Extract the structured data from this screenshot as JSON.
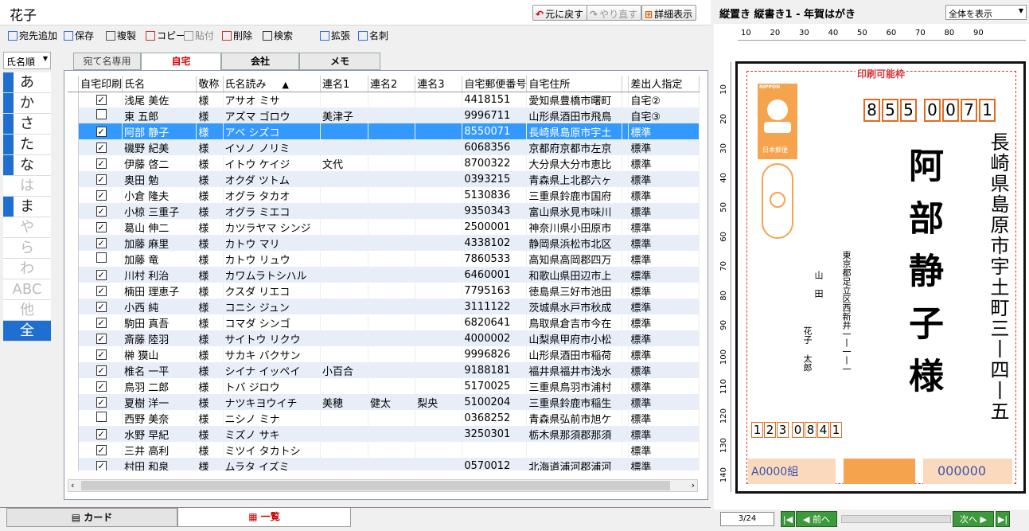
{
  "title": "花子",
  "top_buttons": {
    "undo": "元に戻す",
    "redo": "やり直す",
    "details": "詳細表示"
  },
  "toolbar": [
    "宛先追加",
    "保存",
    "複製",
    "コピー",
    "貼付",
    "削除",
    "検索",
    "拡張",
    "名刺"
  ],
  "sort_label": "氏名順",
  "kana_index": [
    {
      "label": "あ",
      "state": "active"
    },
    {
      "label": "か",
      "state": "active"
    },
    {
      "label": "さ",
      "state": "active"
    },
    {
      "label": "た",
      "state": "active"
    },
    {
      "label": "な",
      "state": "active"
    },
    {
      "label": "は",
      "state": "dim"
    },
    {
      "label": "ま",
      "state": "active"
    },
    {
      "label": "や",
      "state": "dim"
    },
    {
      "label": "ら",
      "state": "dim"
    },
    {
      "label": "わ",
      "state": "dim"
    },
    {
      "label": "ABC",
      "state": "dim"
    },
    {
      "label": "他",
      "state": "dim"
    },
    {
      "label": "全",
      "state": "selected"
    }
  ],
  "tabs": [
    "宛て名専用",
    "自宅",
    "会社",
    "メモ"
  ],
  "active_tab": "自宅",
  "columns": [
    "自宅印刷",
    "氏名",
    "敬称",
    "氏名読み",
    "連名1",
    "連名2",
    "連名3",
    "自宅郵便番号",
    "自宅住所",
    "差出人指定"
  ],
  "sort_indicator": "▲",
  "rows": [
    {
      "checked": true,
      "name": "浅尾 美佐",
      "honor": "様",
      "reading": "アサオ ミサ",
      "r1": "",
      "r2": "",
      "r3": "",
      "zip": "4418151",
      "addr": "愛知県豊橋市曙町",
      "sender": "自宅②"
    },
    {
      "checked": false,
      "name": "東 五郎",
      "honor": "様",
      "reading": "アズマ ゴロウ",
      "r1": "美津子",
      "r2": "",
      "r3": "",
      "zip": "9996711",
      "addr": "山形県酒田市飛鳥",
      "sender": "自宅③"
    },
    {
      "checked": true,
      "name": "阿部 静子",
      "honor": "様",
      "reading": "アベ シズコ",
      "r1": "",
      "r2": "",
      "r3": "",
      "zip": "8550071",
      "addr": "長崎県島原市宇土",
      "sender": "標準",
      "selected": true
    },
    {
      "checked": true,
      "name": "磯野 紀美",
      "honor": "様",
      "reading": "イソノ ノリミ",
      "r1": "",
      "r2": "",
      "r3": "",
      "zip": "6068356",
      "addr": "京都府京都市左京",
      "sender": "標準"
    },
    {
      "checked": true,
      "name": "伊藤 啓二",
      "honor": "様",
      "reading": "イトウ ケイジ",
      "r1": "文代",
      "r2": "",
      "r3": "",
      "zip": "8700322",
      "addr": "大分県大分市恵比",
      "sender": "標準"
    },
    {
      "checked": true,
      "name": "奥田 勉",
      "honor": "様",
      "reading": "オクダ ツトム",
      "r1": "",
      "r2": "",
      "r3": "",
      "zip": "0393215",
      "addr": "青森県上北郡六ヶ",
      "sender": "標準"
    },
    {
      "checked": true,
      "name": "小倉 隆夫",
      "honor": "様",
      "reading": "オグラ タカオ",
      "r1": "",
      "r2": "",
      "r3": "",
      "zip": "5130836",
      "addr": "三重県鈴鹿市国府",
      "sender": "標準"
    },
    {
      "checked": true,
      "name": "小椋 三重子",
      "honor": "様",
      "reading": "オグラ ミエコ",
      "r1": "",
      "r2": "",
      "r3": "",
      "zip": "9350343",
      "addr": "富山県氷見市味川",
      "sender": "標準"
    },
    {
      "checked": true,
      "name": "葛山 伸二",
      "honor": "様",
      "reading": "カツラヤマ シンジ",
      "r1": "",
      "r2": "",
      "r3": "",
      "zip": "2500001",
      "addr": "神奈川県小田原市",
      "sender": "標準"
    },
    {
      "checked": true,
      "name": "加藤 麻里",
      "honor": "様",
      "reading": "カトウ マリ",
      "r1": "",
      "r2": "",
      "r3": "",
      "zip": "4338102",
      "addr": "静岡県浜松市北区",
      "sender": "標準"
    },
    {
      "checked": false,
      "name": "加藤 竜",
      "honor": "様",
      "reading": "カトウ リュウ",
      "r1": "",
      "r2": "",
      "r3": "",
      "zip": "7860533",
      "addr": "高知県高岡郡四万",
      "sender": "標準"
    },
    {
      "checked": true,
      "name": "川村 利治",
      "honor": "様",
      "reading": "カワムラトシハル",
      "r1": "",
      "r2": "",
      "r3": "",
      "zip": "6460001",
      "addr": "和歌山県田辺市上",
      "sender": "標準"
    },
    {
      "checked": true,
      "name": "楠田 理恵子",
      "honor": "様",
      "reading": "クスダ リエコ",
      "r1": "",
      "r2": "",
      "r3": "",
      "zip": "7795163",
      "addr": "徳島県三好市池田",
      "sender": "標準"
    },
    {
      "checked": true,
      "name": "小西 純",
      "honor": "様",
      "reading": "コニシ ジュン",
      "r1": "",
      "r2": "",
      "r3": "",
      "zip": "3111122",
      "addr": "茨城県水戸市秋成",
      "sender": "標準"
    },
    {
      "checked": true,
      "name": "駒田 真吾",
      "honor": "様",
      "reading": "コマダ シンゴ",
      "r1": "",
      "r2": "",
      "r3": "",
      "zip": "6820641",
      "addr": "鳥取県倉吉市今在",
      "sender": "標準"
    },
    {
      "checked": true,
      "name": "斎藤 陸羽",
      "honor": "様",
      "reading": "サイトウ リクウ",
      "r1": "",
      "r2": "",
      "r3": "",
      "zip": "4000002",
      "addr": "山梨県甲府市小松",
      "sender": "標準"
    },
    {
      "checked": true,
      "name": "榊 獏山",
      "honor": "様",
      "reading": "サカキ バクサン",
      "r1": "",
      "r2": "",
      "r3": "",
      "zip": "9996826",
      "addr": "山形県酒田市稲荷",
      "sender": "標準"
    },
    {
      "checked": true,
      "name": "椎名 一平",
      "honor": "様",
      "reading": "シイナ イッペイ",
      "r1": "小百合",
      "r2": "",
      "r3": "",
      "zip": "9188181",
      "addr": "福井県福井市浅水",
      "sender": "標準"
    },
    {
      "checked": true,
      "name": "鳥羽 二郎",
      "honor": "様",
      "reading": "トバ ジロウ",
      "r1": "",
      "r2": "",
      "r3": "",
      "zip": "5170025",
      "addr": "三重県鳥羽市浦村",
      "sender": "標準"
    },
    {
      "checked": true,
      "name": "夏樹 洋一",
      "honor": "様",
      "reading": "ナツキヨウイチ",
      "r1": "美穂",
      "r2": "健太",
      "r3": "梨央",
      "zip": "5100204",
      "addr": "三重県鈴鹿市稲生",
      "sender": "標準"
    },
    {
      "checked": false,
      "name": "西野 美奈",
      "honor": "様",
      "reading": "ニシノ ミナ",
      "r1": "",
      "r2": "",
      "r3": "",
      "zip": "0368252",
      "addr": "青森県弘前市旭ケ",
      "sender": "標準"
    },
    {
      "checked": true,
      "name": "水野 早紀",
      "honor": "様",
      "reading": "ミズノ サキ",
      "r1": "",
      "r2": "",
      "r3": "",
      "zip": "3250301",
      "addr": "栃木県那須郡那須",
      "sender": "標準"
    },
    {
      "checked": true,
      "name": "三井 高利",
      "honor": "様",
      "reading": "ミツイ タカトシ",
      "r1": "",
      "r2": "",
      "r3": "",
      "zip": "",
      "addr": "",
      "sender": "標準"
    },
    {
      "checked": true,
      "name": "村田 和泉",
      "honor": "様",
      "reading": "ムラタ イズミ",
      "r1": "",
      "r2": "",
      "r3": "",
      "zip": "0570012",
      "addr": "北海道浦河郡浦河",
      "sender": "標準"
    }
  ],
  "bottom_tabs": {
    "card": "カード",
    "list": "一覧"
  },
  "preview": {
    "title": "縦置き 縦書き1 - 年賀はがき",
    "zoom": "全体を表示",
    "ruler_top": [
      "10",
      "20",
      "30",
      "40",
      "50",
      "60",
      "70",
      "80",
      "90"
    ],
    "ruler_left": [
      "10",
      "20",
      "30",
      "40",
      "50",
      "60",
      "70",
      "80",
      "90",
      "100",
      "110",
      "120",
      "130",
      "140"
    ],
    "print_area_label": "印刷可能枠",
    "stamp_text": "NIPPON",
    "stamp_caption": "日本郵便",
    "recipient_zip": [
      "8",
      "5",
      "5",
      "0",
      "0",
      "7",
      "1"
    ],
    "recipient_address": "長崎県島原市宇土町三丨四丨五",
    "recipient_name": "阿部静子様",
    "sender_address": "東京都足立区西新井一丨一丨一",
    "sender_names": [
      "山田",
      "花子",
      "太郎"
    ],
    "sender_zip": [
      "1",
      "2",
      "3",
      "0",
      "8",
      "4",
      "1"
    ],
    "lottery_left": "A0000組",
    "lottery_right": "000000",
    "page": "3/24",
    "prev_label": "前へ",
    "next_label": "次へ"
  }
}
